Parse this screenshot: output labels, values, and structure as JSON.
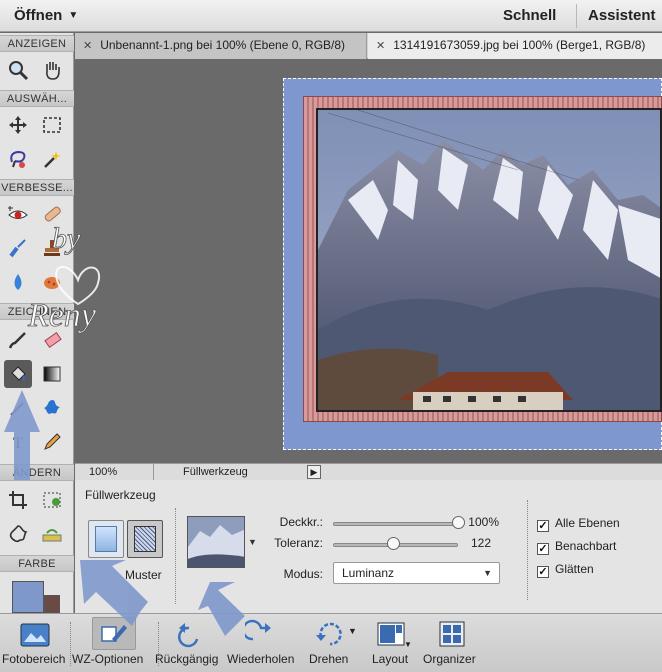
{
  "topbar": {
    "open_label": "Öffnen",
    "schnell": "Schnell",
    "assistent": "Assistent"
  },
  "toolbox": {
    "sections": [
      "ANZEIGEN",
      "AUSWÄH...",
      "VERBESSE...",
      "ZEICHNEN",
      "ÄNDERN",
      "FARBE"
    ],
    "foreground_color": "#7f98cc",
    "background_color": "#6b4a45"
  },
  "tabs": [
    {
      "label": "Unbenannt-1.png bei 100% (Ebene 0, RGB/8)"
    },
    {
      "label": "1314191673059.jpg bei 100% (Berge1, RGB/8)"
    }
  ],
  "statusbar": {
    "zoom": "100%",
    "tool": "Füllwerkzeug"
  },
  "options": {
    "title": "Füllwerkzeug",
    "pattern_label": "Muster",
    "opacity_label": "Deckkr.:",
    "opacity_value": "100%",
    "opacity_fraction": 1.0,
    "tolerance_label": "Toleranz:",
    "tolerance_value": "122",
    "tolerance_fraction": 0.48,
    "mode_label": "Modus:",
    "mode_value": "Luminanz",
    "checkboxes": [
      {
        "label": "Alle Ebenen",
        "checked": true
      },
      {
        "label": "Benachbart",
        "checked": true
      },
      {
        "label": "Glätten",
        "checked": true
      }
    ]
  },
  "bottombar": {
    "buttons": [
      "Fotobereich",
      "WZ-Optionen",
      "Rückgängig",
      "Wiederholen",
      "Drehen",
      "Layout",
      "Organizer"
    ]
  },
  "watermark": "by Reny",
  "accent_color": "#7f98cc"
}
